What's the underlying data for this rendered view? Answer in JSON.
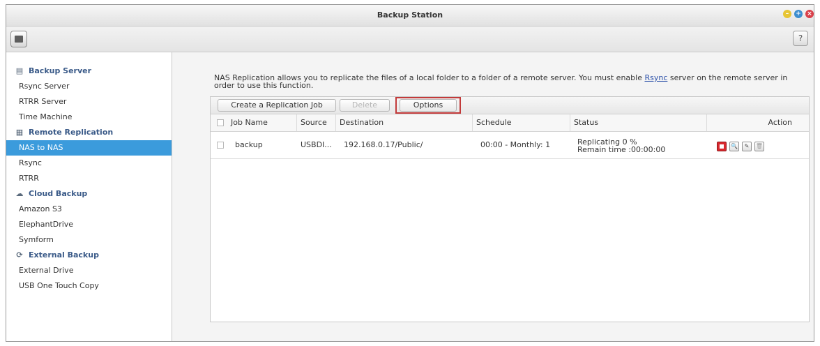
{
  "window": {
    "title": "Backup Station",
    "help_label": "?",
    "controls": {
      "minimize": "minimize-icon",
      "maximize": "maximize-icon",
      "close": "close-icon",
      "colors": {
        "minimize": "#e7c534",
        "maximize": "#3e8ecf",
        "close": "#d9404a"
      }
    }
  },
  "sidebar": {
    "sections": [
      {
        "label": "Backup Server",
        "icon": "server-icon",
        "items": [
          {
            "label": "Rsync Server"
          },
          {
            "label": "RTRR Server"
          },
          {
            "label": "Time Machine"
          }
        ]
      },
      {
        "label": "Remote Replication",
        "icon": "replication-icon",
        "items": [
          {
            "label": "NAS to NAS",
            "active": true
          },
          {
            "label": "Rsync"
          },
          {
            "label": "RTRR"
          }
        ]
      },
      {
        "label": "Cloud Backup",
        "icon": "cloud-icon",
        "items": [
          {
            "label": "Amazon S3"
          },
          {
            "label": "ElephantDrive"
          },
          {
            "label": "Symform"
          }
        ]
      },
      {
        "label": "External Backup",
        "icon": "sync-icon",
        "items": [
          {
            "label": "External Drive"
          },
          {
            "label": "USB One Touch Copy"
          }
        ]
      }
    ],
    "accent_color": "#3b9bdc"
  },
  "main": {
    "description_part1": "NAS Replication allows you to replicate the files of a local folder to a folder of a remote server. You must enable ",
    "description_link": "Rsync",
    "description_part2": " server on the remote server in order to use this function.",
    "buttons": {
      "create": "Create a Replication Job",
      "delete": "Delete",
      "options": "Options"
    },
    "columns": [
      "Job Name",
      "Source",
      "Destination",
      "Schedule",
      "Status",
      "Action"
    ],
    "jobs": [
      {
        "name": "backup",
        "source": "USBDI...",
        "destination": "192.168.0.17/Public/",
        "schedule": "00:00 - Monthly: 1",
        "status_line1": "Replicating 0 %",
        "status_line2": "Remain time :00:00:00"
      }
    ]
  }
}
